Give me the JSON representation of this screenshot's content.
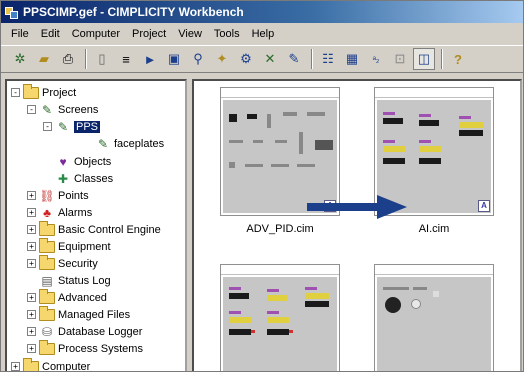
{
  "window": {
    "title": "PPSCIMP.gef - CIMPLICITY Workbench"
  },
  "menu": [
    "File",
    "Edit",
    "Computer",
    "Project",
    "View",
    "Tools",
    "Help"
  ],
  "toolbar": {
    "buttons": [
      "new-project-icon",
      "open-icon",
      "print-icon",
      "properties-icon",
      "list-icon",
      "run-icon",
      "screen-icon",
      "preview-icon",
      "wizard-icon",
      "config-icon",
      "tools-icon",
      "extend-icon",
      "details-icon",
      "large-icons-icon",
      "small-icons-icon",
      "list-view-icon",
      "thumbnail-view-icon",
      "help-icon"
    ]
  },
  "tree": {
    "items": [
      {
        "label": "Project",
        "expander": "-",
        "icon": "folder"
      },
      {
        "label": "Screens",
        "expander": "-",
        "icon": "screens"
      },
      {
        "label": "PPS",
        "expander": "-",
        "icon": "screens",
        "selected": true
      },
      {
        "label": "faceplates",
        "expander": "",
        "icon": "screens"
      },
      {
        "label": "Objects",
        "expander": "",
        "icon": "objects"
      },
      {
        "label": "Classes",
        "expander": "",
        "icon": "classes"
      },
      {
        "label": "Points",
        "expander": "+",
        "icon": "points"
      },
      {
        "label": "Alarms",
        "expander": "+",
        "icon": "alarms"
      },
      {
        "label": "Basic Control Engine",
        "expander": "+",
        "icon": "folder"
      },
      {
        "label": "Equipment",
        "expander": "+",
        "icon": "folder"
      },
      {
        "label": "Security",
        "expander": "+",
        "icon": "folder"
      },
      {
        "label": "Status Log",
        "expander": "",
        "icon": "statuslog"
      },
      {
        "label": "Advanced",
        "expander": "+",
        "icon": "folder"
      },
      {
        "label": "Managed Files",
        "expander": "+",
        "icon": "folder"
      },
      {
        "label": "Database Logger",
        "expander": "+",
        "icon": "database"
      },
      {
        "label": "Process Systems",
        "expander": "+",
        "icon": "folder"
      },
      {
        "label": "Computer",
        "expander": "+",
        "icon": "folder"
      }
    ]
  },
  "files": [
    {
      "name": "ADV_PID.cim"
    },
    {
      "name": "AI.cim"
    },
    {
      "name": ""
    },
    {
      "name": ""
    }
  ],
  "colors": {
    "title_start": "#0a246a",
    "selection": "#0a246a",
    "arrow": "#1c3f8c"
  }
}
